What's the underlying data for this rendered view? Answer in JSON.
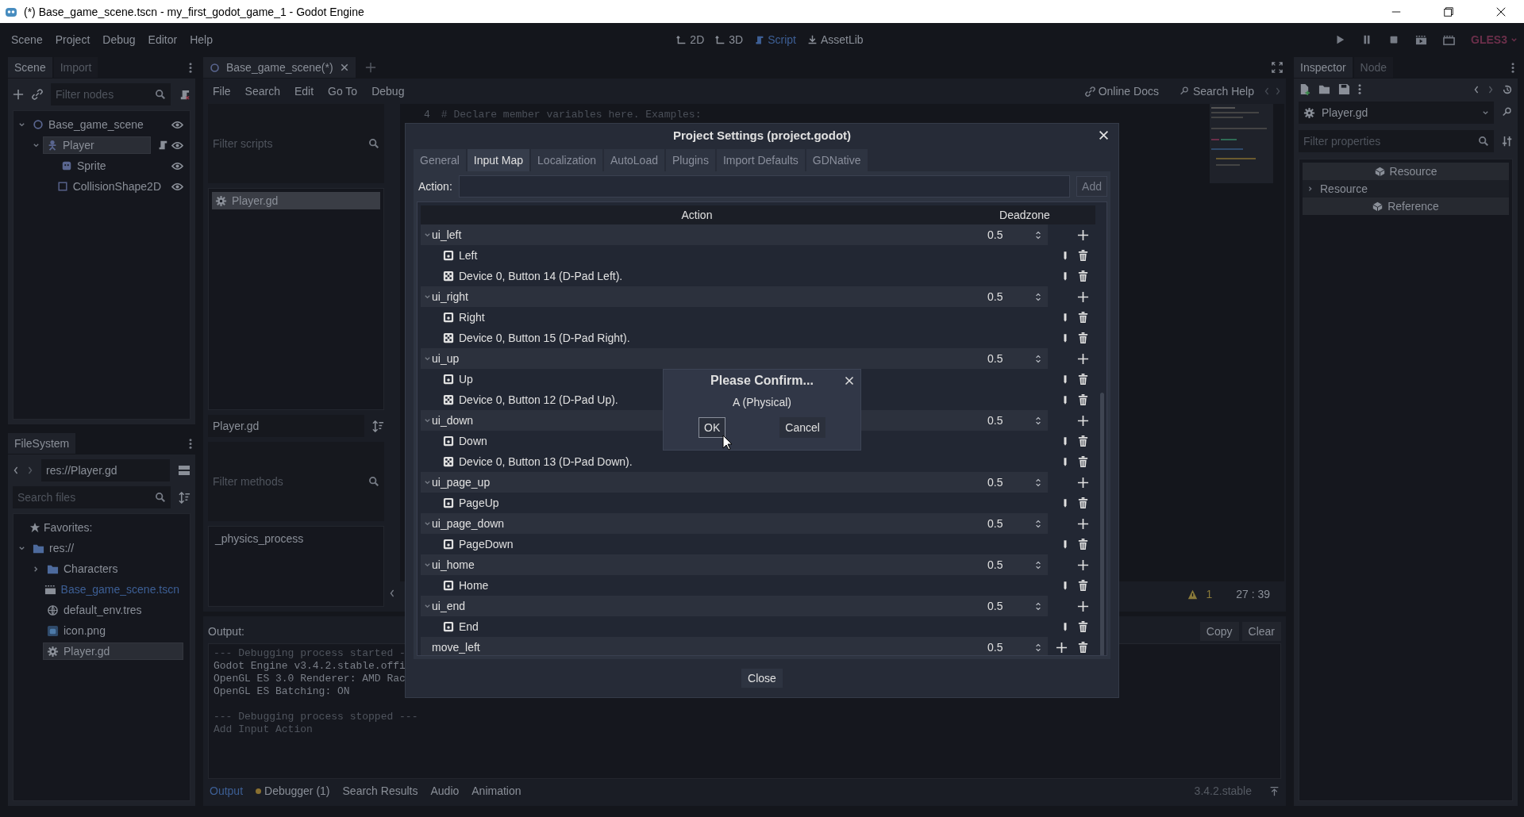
{
  "window": {
    "title": "(*) Base_game_scene.tscn - my_first_godot_game_1 - Godot Engine"
  },
  "menu": [
    "Scene",
    "Project",
    "Debug",
    "Editor",
    "Help"
  ],
  "workspaces": [
    {
      "label": "2D",
      "kind": "planar",
      "selected": false
    },
    {
      "label": "3D",
      "kind": "spatial",
      "selected": false
    },
    {
      "label": "Script",
      "kind": "script",
      "selected": true
    },
    {
      "label": "AssetLib",
      "kind": "assetlib",
      "selected": false
    }
  ],
  "renderer": "GLES3",
  "scene_dock": {
    "tabs": [
      {
        "label": "Scene",
        "selected": true
      },
      {
        "label": "Import",
        "selected": false
      }
    ],
    "filter_placeholder": "Filter nodes",
    "nodes": [
      {
        "name": "Base_game_scene",
        "kind": "node2d",
        "selected": false,
        "expanded": true,
        "children": [
          {
            "name": "Player",
            "kind": "body",
            "selected": true,
            "script": true,
            "expanded": true,
            "children": [
              {
                "name": "Sprite",
                "kind": "sprite",
                "selected": false
              },
              {
                "name": "CollisionShape2D",
                "kind": "shape",
                "selected": false
              }
            ]
          }
        ]
      }
    ]
  },
  "filesystem": {
    "title": "FileSystem",
    "path": "res://Player.gd",
    "search_placeholder": "Search files",
    "favorites": "Favorites:",
    "tree": [
      {
        "name": "res://",
        "kind": "folder",
        "expanded": true,
        "selected": false,
        "current": false,
        "children": [
          {
            "name": "Characters",
            "kind": "folder",
            "expanded": false,
            "selected": false,
            "current": false
          },
          {
            "name": "Base_game_scene.tscn",
            "kind": "scene",
            "selected": false,
            "current": true
          },
          {
            "name": "default_env.tres",
            "kind": "env",
            "selected": false,
            "current": false
          },
          {
            "name": "icon.png",
            "kind": "image",
            "selected": false,
            "current": false
          },
          {
            "name": "Player.gd",
            "kind": "script",
            "selected": true,
            "current": false
          }
        ]
      }
    ]
  },
  "script_editor": {
    "tab": "Base_game_scene(*)",
    "menu": [
      "File",
      "Search",
      "Edit",
      "Go To",
      "Debug"
    ],
    "filter_scripts_placeholder": "Filter scripts",
    "scripts": [
      {
        "name": "Player.gd",
        "selected": true
      }
    ],
    "current_script": "Player.gd",
    "filter_methods_placeholder": "Filter methods",
    "methods": [
      "_physics_process"
    ],
    "help_links": [
      {
        "label": "Online Docs",
        "kind": "docs"
      },
      {
        "label": "Search Help",
        "kind": "help"
      }
    ],
    "code_lines": [
      {
        "number": "4",
        "text": "# Declare member variables here. Examples:"
      }
    ],
    "warnings": "1",
    "cursor_position": "27 : 39"
  },
  "output": {
    "label": "Output:",
    "lines": [
      {
        "text": "--- Debugging process started -",
        "kind": "dim"
      },
      {
        "text": "Godot Engine v3.4.2.stable.offi",
        "kind": "normal"
      },
      {
        "text": "OpenGL ES 3.0 Renderer: AMD Rac",
        "kind": "normal"
      },
      {
        "text": "OpenGL ES Batching: ON",
        "kind": "normal"
      },
      {
        "text": "--- Debugging process stopped ---",
        "kind": "dim",
        "gap_before": true
      },
      {
        "text": "Add Input Action",
        "kind": "dim"
      }
    ],
    "buttons": [
      "Copy",
      "Clear"
    ],
    "tabs": [
      {
        "label": "Output",
        "selected": true,
        "alert": false
      },
      {
        "label": "Debugger (1)",
        "selected": false,
        "alert": true
      },
      {
        "label": "Search Results",
        "selected": false,
        "alert": false
      },
      {
        "label": "Audio",
        "selected": false,
        "alert": false
      },
      {
        "label": "Animation",
        "selected": false,
        "alert": false
      }
    ],
    "version": "3.4.2.stable"
  },
  "inspector": {
    "tabs": [
      {
        "label": "Inspector",
        "selected": true
      },
      {
        "label": "Node",
        "selected": false
      }
    ],
    "resource": "Player.gd",
    "filter_placeholder": "Filter properties",
    "sections": [
      {
        "label": "Resource",
        "kind": "category"
      },
      {
        "label": "Resource",
        "kind": "group"
      },
      {
        "label": "Reference",
        "kind": "category"
      }
    ]
  },
  "project_settings": {
    "title": "Project Settings (project.godot)",
    "tabs": [
      {
        "label": "General",
        "selected": false
      },
      {
        "label": "Input Map",
        "selected": true
      },
      {
        "label": "Localization",
        "selected": false
      },
      {
        "label": "AutoLoad",
        "selected": false
      },
      {
        "label": "Plugins",
        "selected": false
      },
      {
        "label": "Import Defaults",
        "selected": false
      },
      {
        "label": "GDNative",
        "selected": false
      }
    ],
    "action_label": "Action:",
    "add_button": "Add",
    "columns": [
      "Action",
      "Deadzone"
    ],
    "actions": [
      {
        "name": "ui_left",
        "deadzone": "0.5",
        "expanded": true,
        "events": [
          {
            "label": "Left",
            "kind": "key"
          },
          {
            "label": "Device 0, Button 14 (D-Pad Left).",
            "kind": "joypad"
          }
        ]
      },
      {
        "name": "ui_right",
        "deadzone": "0.5",
        "expanded": true,
        "events": [
          {
            "label": "Right",
            "kind": "key"
          },
          {
            "label": "Device 0, Button 15 (D-Pad Right).",
            "kind": "joypad"
          }
        ]
      },
      {
        "name": "ui_up",
        "deadzone": "0.5",
        "expanded": true,
        "events": [
          {
            "label": "Up",
            "kind": "key"
          },
          {
            "label": "Device 0, Button 12 (D-Pad Up).",
            "kind": "joypad"
          }
        ]
      },
      {
        "name": "ui_down",
        "deadzone": "0.5",
        "expanded": true,
        "events": [
          {
            "label": "Down",
            "kind": "key"
          },
          {
            "label": "Device 0, Button 13 (D-Pad Down).",
            "kind": "joypad"
          }
        ]
      },
      {
        "name": "ui_page_up",
        "deadzone": "0.5",
        "expanded": true,
        "events": [
          {
            "label": "PageUp",
            "kind": "key"
          }
        ]
      },
      {
        "name": "ui_page_down",
        "deadzone": "0.5",
        "expanded": true,
        "events": [
          {
            "label": "PageDown",
            "kind": "key"
          }
        ]
      },
      {
        "name": "ui_home",
        "deadzone": "0.5",
        "expanded": true,
        "events": [
          {
            "label": "Home",
            "kind": "key"
          }
        ]
      },
      {
        "name": "ui_end",
        "deadzone": "0.5",
        "expanded": true,
        "events": [
          {
            "label": "End",
            "kind": "key"
          }
        ]
      },
      {
        "name": "move_left",
        "deadzone": "0.5",
        "removable": true
      }
    ],
    "close_button": "Close"
  },
  "confirm": {
    "title": "Please Confirm...",
    "message": "A (Physical)",
    "buttons": [
      {
        "label": "OK",
        "focused": true
      },
      {
        "label": "Cancel",
        "focused": false
      }
    ]
  }
}
